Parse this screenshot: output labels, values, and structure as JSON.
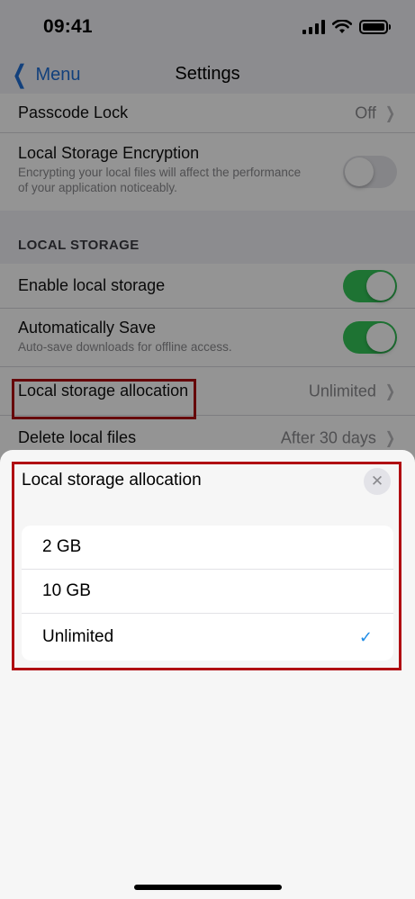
{
  "status_bar": {
    "time": "09:41"
  },
  "nav": {
    "back_label": "Menu",
    "title": "Settings"
  },
  "settings": {
    "passcode_lock": {
      "label": "Passcode Lock",
      "value": "Off"
    },
    "encryption": {
      "label": "Local Storage Encryption",
      "subtitle": "Encrypting your local files will affect the performance of your application noticeably.",
      "enabled": false
    },
    "section_header": "LOCAL STORAGE",
    "enable_local_storage": {
      "label": "Enable local storage",
      "enabled": true
    },
    "auto_save": {
      "label": "Automatically Save",
      "subtitle": "Auto-save downloads for offline access.",
      "enabled": true
    },
    "allocation": {
      "label": "Local storage allocation",
      "value": "Unlimited"
    },
    "delete_files": {
      "label": "Delete local files",
      "value": "After 30 days"
    }
  },
  "sheet": {
    "title": "Local storage allocation",
    "options": [
      {
        "label": "2 GB",
        "selected": false
      },
      {
        "label": "10 GB",
        "selected": false
      },
      {
        "label": "Unlimited",
        "selected": true
      }
    ]
  },
  "colors": {
    "accent": "#1f6fd6",
    "toggle_on": "#34c759",
    "highlight": "#b00e12",
    "checkmark": "#1f8ce6"
  },
  "icons": {
    "back": "chevron-left-icon",
    "chevron": "chevron-right-icon",
    "close": "close-icon",
    "check": "checkmark-icon",
    "signal": "cellular-signal-icon",
    "wifi": "wifi-icon",
    "battery": "battery-icon"
  }
}
